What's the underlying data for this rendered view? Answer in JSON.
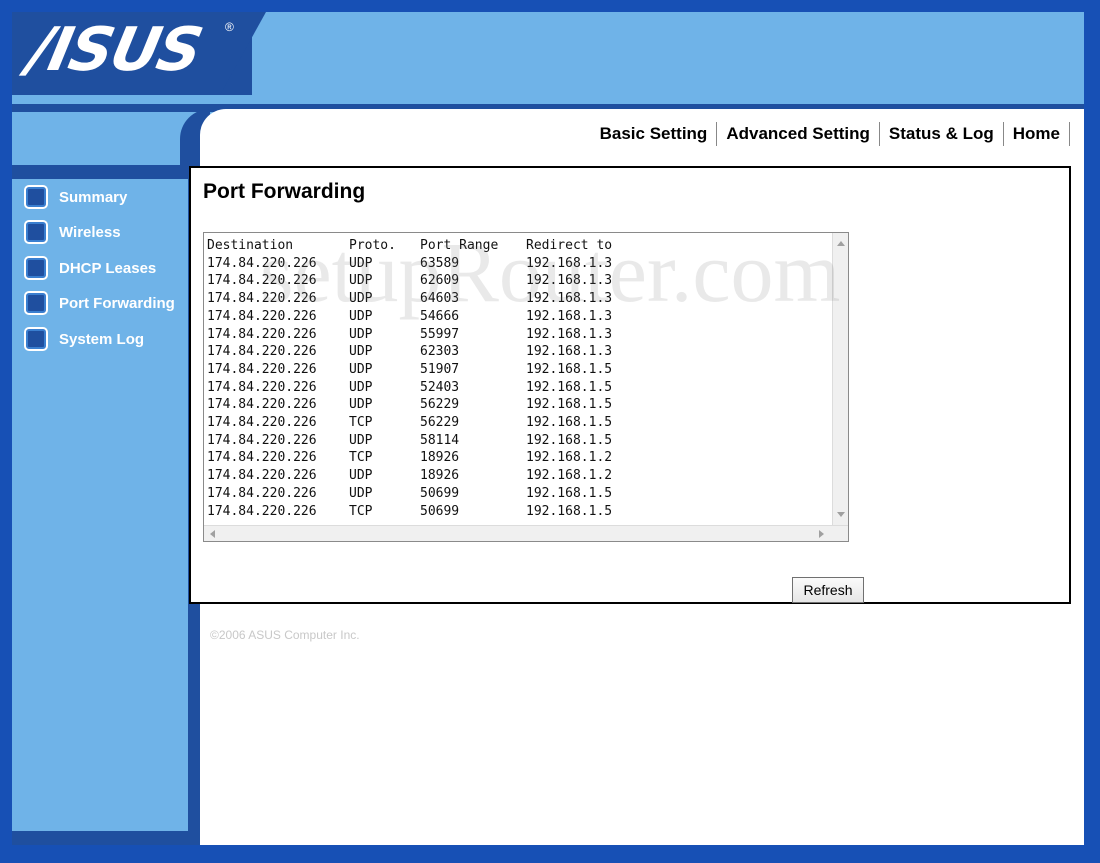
{
  "brand": {
    "logo_text": "/ISUS",
    "registered_mark": "®"
  },
  "top_nav": {
    "items": [
      "Basic Setting",
      "Advanced Setting",
      "Status & Log",
      "Home"
    ]
  },
  "sidebar": {
    "items": [
      {
        "label": "Summary"
      },
      {
        "label": "Wireless"
      },
      {
        "label": "DHCP Leases"
      },
      {
        "label": "Port Forwarding"
      },
      {
        "label": "System Log"
      }
    ]
  },
  "main": {
    "title": "Port Forwarding",
    "table": {
      "headers": [
        "Destination",
        "Proto.",
        "Port Range",
        "Redirect to"
      ],
      "rows": [
        [
          "174.84.220.226",
          "UDP",
          "63589",
          "192.168.1.3"
        ],
        [
          "174.84.220.226",
          "UDP",
          "62609",
          "192.168.1.3"
        ],
        [
          "174.84.220.226",
          "UDP",
          "64603",
          "192.168.1.3"
        ],
        [
          "174.84.220.226",
          "UDP",
          "54666",
          "192.168.1.3"
        ],
        [
          "174.84.220.226",
          "UDP",
          "55997",
          "192.168.1.3"
        ],
        [
          "174.84.220.226",
          "UDP",
          "62303",
          "192.168.1.3"
        ],
        [
          "174.84.220.226",
          "UDP",
          "51907",
          "192.168.1.5"
        ],
        [
          "174.84.220.226",
          "UDP",
          "52403",
          "192.168.1.5"
        ],
        [
          "174.84.220.226",
          "UDP",
          "56229",
          "192.168.1.5"
        ],
        [
          "174.84.220.226",
          "TCP",
          "56229",
          "192.168.1.5"
        ],
        [
          "174.84.220.226",
          "UDP",
          "58114",
          "192.168.1.5"
        ],
        [
          "174.84.220.226",
          "TCP",
          "18926",
          "192.168.1.2"
        ],
        [
          "174.84.220.226",
          "UDP",
          "18926",
          "192.168.1.2"
        ],
        [
          "174.84.220.226",
          "UDP",
          "50699",
          "192.168.1.5"
        ],
        [
          "174.84.220.226",
          "TCP",
          "50699",
          "192.168.1.5"
        ]
      ]
    },
    "refresh_label": "Refresh"
  },
  "footer": {
    "copyright": "©2006 ASUS Computer Inc."
  },
  "watermark": "setupRouter.com",
  "colors": {
    "outer": "#1750b5",
    "dark_blue": "#1f4f9f",
    "light_blue": "#6fb3e8",
    "content_bg": "#ffffff"
  }
}
